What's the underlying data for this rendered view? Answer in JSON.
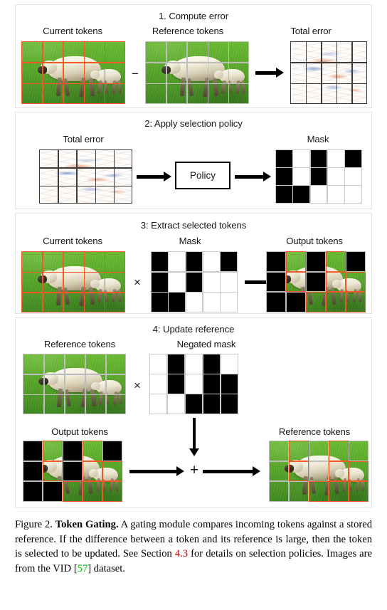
{
  "figure": {
    "panels": [
      {
        "id": "compute-error",
        "title": "1. Compute error",
        "labels": {
          "left": "Current tokens",
          "middle": "Reference tokens",
          "right": "Total error"
        },
        "operators": {
          "minus": "−"
        }
      },
      {
        "id": "apply-selection-policy",
        "title": "2: Apply selection policy",
        "labels": {
          "left": "Total error",
          "right": "Mask"
        },
        "policy_box_label": "Policy"
      },
      {
        "id": "extract-selected-tokens",
        "title": "3: Extract selected tokens",
        "labels": {
          "left": "Current tokens",
          "middle": "Mask",
          "right": "Output tokens"
        },
        "operators": {
          "times": "×"
        }
      },
      {
        "id": "update-reference",
        "title": "4: Update reference",
        "labels": {
          "top_left": "Reference tokens",
          "top_middle": "Negated mask",
          "bottom_left": "Output tokens",
          "bottom_right": "Reference tokens"
        },
        "operators": {
          "times": "×",
          "plus": "+"
        }
      }
    ]
  },
  "mask": {
    "rows": 3,
    "cols": 5,
    "cells": [
      [
        1,
        0,
        1,
        0,
        1
      ],
      [
        1,
        0,
        1,
        0,
        0
      ],
      [
        1,
        1,
        0,
        0,
        0
      ]
    ]
  },
  "negated_mask": {
    "rows": 3,
    "cols": 5,
    "cells": [
      [
        0,
        1,
        0,
        1,
        0
      ],
      [
        0,
        1,
        0,
        1,
        1
      ],
      [
        0,
        0,
        1,
        1,
        1
      ]
    ]
  },
  "colors": {
    "selected_grid": "#f15a22",
    "unselected_grid": "#bdbdbd",
    "error_positive": "#d66228",
    "error_negative": "#386aba",
    "panel_border": "#e2e2e2",
    "mask_on": "#000000",
    "mask_off": "#ffffff",
    "citation_section": "#cc0000",
    "citation_ref": "#00bb00"
  },
  "caption": {
    "figure_number": "Figure 2.",
    "bold_title": "Token Gating.",
    "text_part_1": "A gating module compares incoming tokens against a stored reference. If the difference between a token and its reference is large, then the token is selected to be updated. See Section ",
    "section_ref": "4.3",
    "text_part_2": " for details on selection policies. Images are from the VID [",
    "citation_number": "57",
    "text_part_3": "] dataset."
  }
}
